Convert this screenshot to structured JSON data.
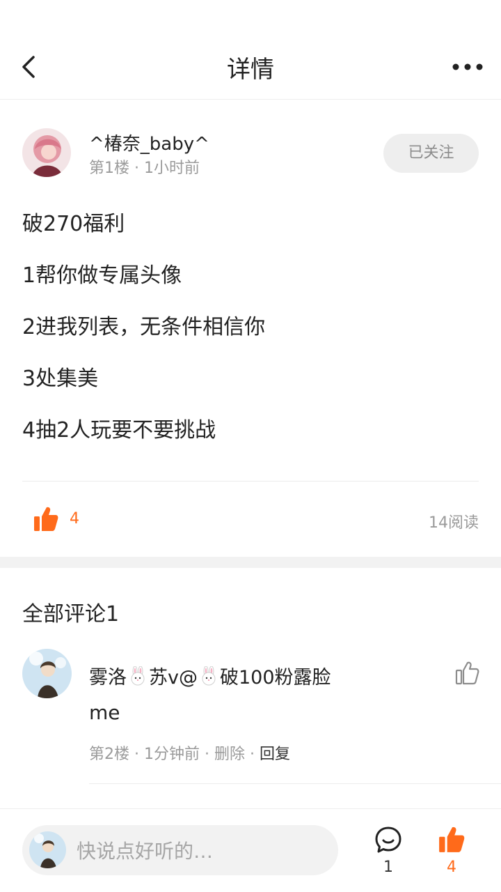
{
  "header": {
    "title": "详情"
  },
  "post": {
    "author": "^椿奈_baby^",
    "floor": "第1楼",
    "time": "1小时前",
    "follow_label": "已关注",
    "lines": [
      "破270福利",
      "1帮你做专属头像",
      "2进我列表，无条件相信你",
      "3处集美",
      "4抽2人玩要不要挑战"
    ],
    "like_count": "4",
    "read_count": "14阅读"
  },
  "comments": {
    "title": "全部评论1",
    "items": [
      {
        "name_part1": "雾洛",
        "name_part2": "苏v@",
        "name_part3": "破100粉露脸",
        "text": "me",
        "floor": "第2楼",
        "time": "1分钟前",
        "delete_label": "删除",
        "reply_label": "回复"
      }
    ]
  },
  "bottom_bar": {
    "placeholder": "快说点好听的…",
    "comment_count": "1",
    "like_count": "4"
  },
  "colors": {
    "accent": "#ff6a1a",
    "muted": "#9a9a9a"
  },
  "icons": [
    "back-arrow-icon",
    "more-dots-icon",
    "thumbs-up-icon",
    "comment-bubble-icon",
    "rabbit-emoji-icon"
  ]
}
